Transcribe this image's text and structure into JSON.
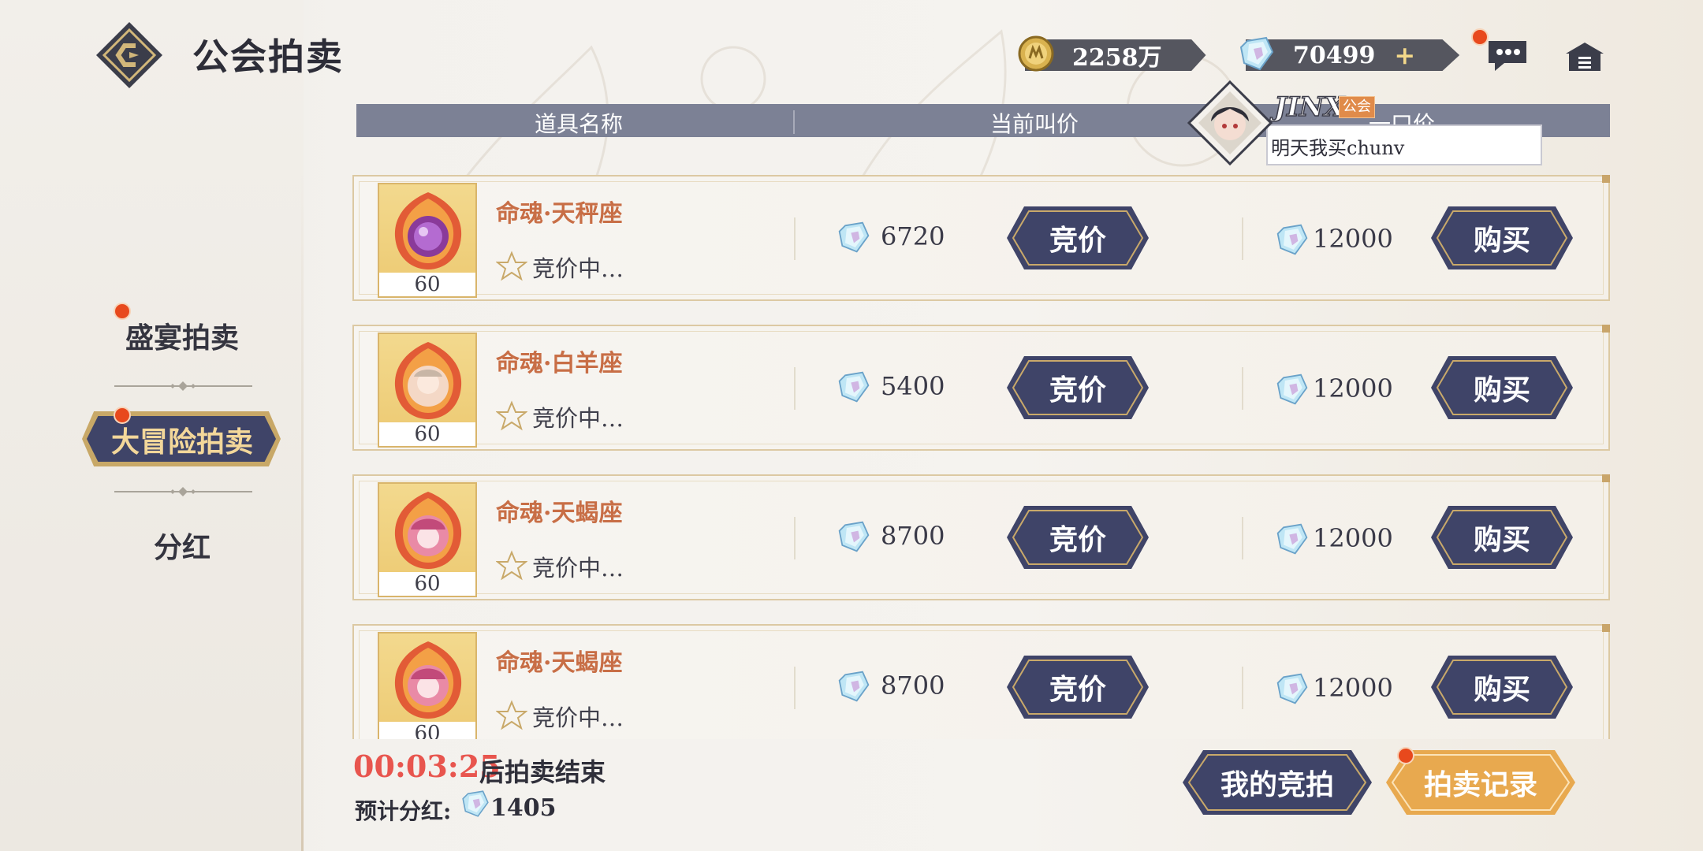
{
  "header": {
    "title": "公会拍卖",
    "gold": "2258万",
    "gems": "70499",
    "plus": "+"
  },
  "tabs": [
    {
      "label": "盛宴拍卖",
      "has_dot": true
    },
    {
      "label": "大冒险拍卖",
      "has_dot": true,
      "active": true
    },
    {
      "label": "分红",
      "has_dot": false
    }
  ],
  "columns": {
    "name": "道具名称",
    "bid": "当前叫价",
    "buyout": "一口价"
  },
  "partial_row_count": "60",
  "items": [
    {
      "name": "命魂·天秤座",
      "count": "60",
      "status": "竞价中…",
      "bid": "6720",
      "bid_button": "竞价",
      "buyout": "12000",
      "buy_button": "购买"
    },
    {
      "name": "命魂·白羊座",
      "count": "60",
      "status": "竞价中…",
      "bid": "5400",
      "bid_button": "竞价",
      "buyout": "12000",
      "buy_button": "购买"
    },
    {
      "name": "命魂·天蝎座",
      "count": "60",
      "status": "竞价中…",
      "bid": "8700",
      "bid_button": "竞价",
      "buyout": "12000",
      "buy_button": "购买"
    },
    {
      "name": "命魂·天蝎座",
      "count": "60",
      "status": "竞价中…",
      "bid": "8700",
      "bid_button": "竞价",
      "buyout": "12000",
      "buy_button": "购买"
    }
  ],
  "footer": {
    "timer": "00:03:25",
    "timer_suffix": "后拍卖结束",
    "dividend_label": "预计分红:",
    "dividend_value": "1405",
    "my_bids": "我的竞拍",
    "records": "拍卖记录"
  },
  "chat": {
    "name": "JINX",
    "tag": "公会",
    "message": "明天我买chunv"
  },
  "colors": {
    "accent_navy": "#3f4468",
    "gold_trim": "#c9a56a",
    "orange_button": "#e8a94f",
    "red_timer": "#e8554e",
    "item_name": "#c86e46"
  }
}
